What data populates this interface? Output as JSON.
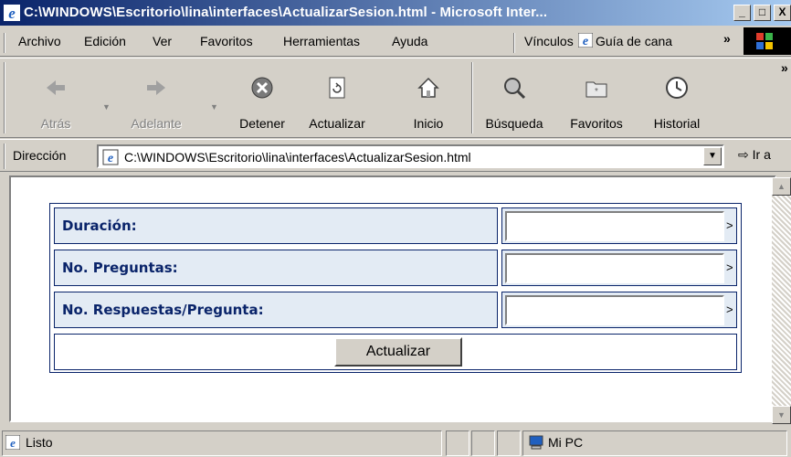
{
  "window": {
    "title": "C:\\WINDOWS\\Escritorio\\lina\\interfaces\\ActualizarSesion.html - Microsoft Inter...",
    "controls": [
      "_",
      "□",
      "X"
    ]
  },
  "menu": {
    "items": [
      "Archivo",
      "Edición",
      "Ver",
      "Favoritos",
      "Herramientas",
      "Ayuda"
    ],
    "links_label": "Vínculos",
    "link_guide": "Guía de cana",
    "overflow": "»"
  },
  "toolbar": {
    "back": "Atrás",
    "forward": "Adelante",
    "stop": "Detener",
    "refresh": "Actualizar",
    "home": "Inicio",
    "search": "Búsqueda",
    "favorites": "Favoritos",
    "history": "Historial",
    "overflow": "»"
  },
  "address": {
    "label": "Dirección",
    "url": "C:\\WINDOWS\\Escritorio\\lina\\interfaces\\ActualizarSesion.html",
    "go": "Ir a"
  },
  "form": {
    "rows": [
      {
        "label": "Duración:",
        "value": "",
        "suffix": ">"
      },
      {
        "label": "No. Preguntas:",
        "value": "",
        "suffix": ">"
      },
      {
        "label": "No. Respuestas/Pregunta:",
        "value": "",
        "suffix": ">"
      }
    ],
    "submit_label": "Actualizar"
  },
  "status": {
    "text": "Listo",
    "zone": "Mi PC"
  },
  "colors": {
    "title_start": "#0a246a",
    "title_end": "#a6caf0",
    "form_border": "#0a246a",
    "label_bg": "#e3ebf4"
  }
}
